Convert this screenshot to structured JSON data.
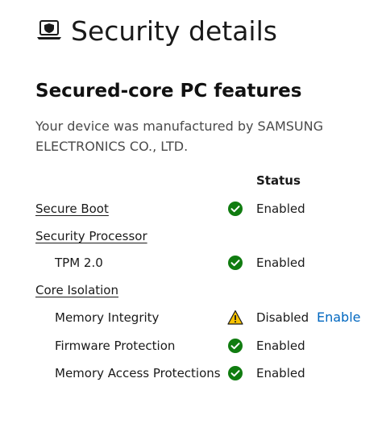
{
  "header": {
    "title": "Security details",
    "icon": "laptop-shield-icon"
  },
  "section": {
    "title": "Secured-core PC features",
    "description": "Your device was manufactured by SAMSUNG ELECTRONICS CO., LTD."
  },
  "table": {
    "status_header": "Status",
    "rows": [
      {
        "label": "Secure Boot",
        "status": "Enabled",
        "status_icon": "check-circle-icon"
      },
      {
        "label": "Security Processor"
      },
      {
        "label": "TPM 2.0",
        "status": "Enabled",
        "status_icon": "check-circle-icon"
      },
      {
        "label": "Core Isolation"
      },
      {
        "label": "Memory Integrity",
        "status": "Disabled",
        "status_icon": "warning-triangle-icon",
        "action": "Enable"
      },
      {
        "label": "Firmware Protection",
        "status": "Enabled",
        "status_icon": "check-circle-icon"
      },
      {
        "label": "Memory Access Protections",
        "status": "Enabled",
        "status_icon": "check-circle-icon"
      }
    ]
  },
  "colors": {
    "success": "#107c10",
    "warning": "#f7c200",
    "link": "#0067c0"
  }
}
